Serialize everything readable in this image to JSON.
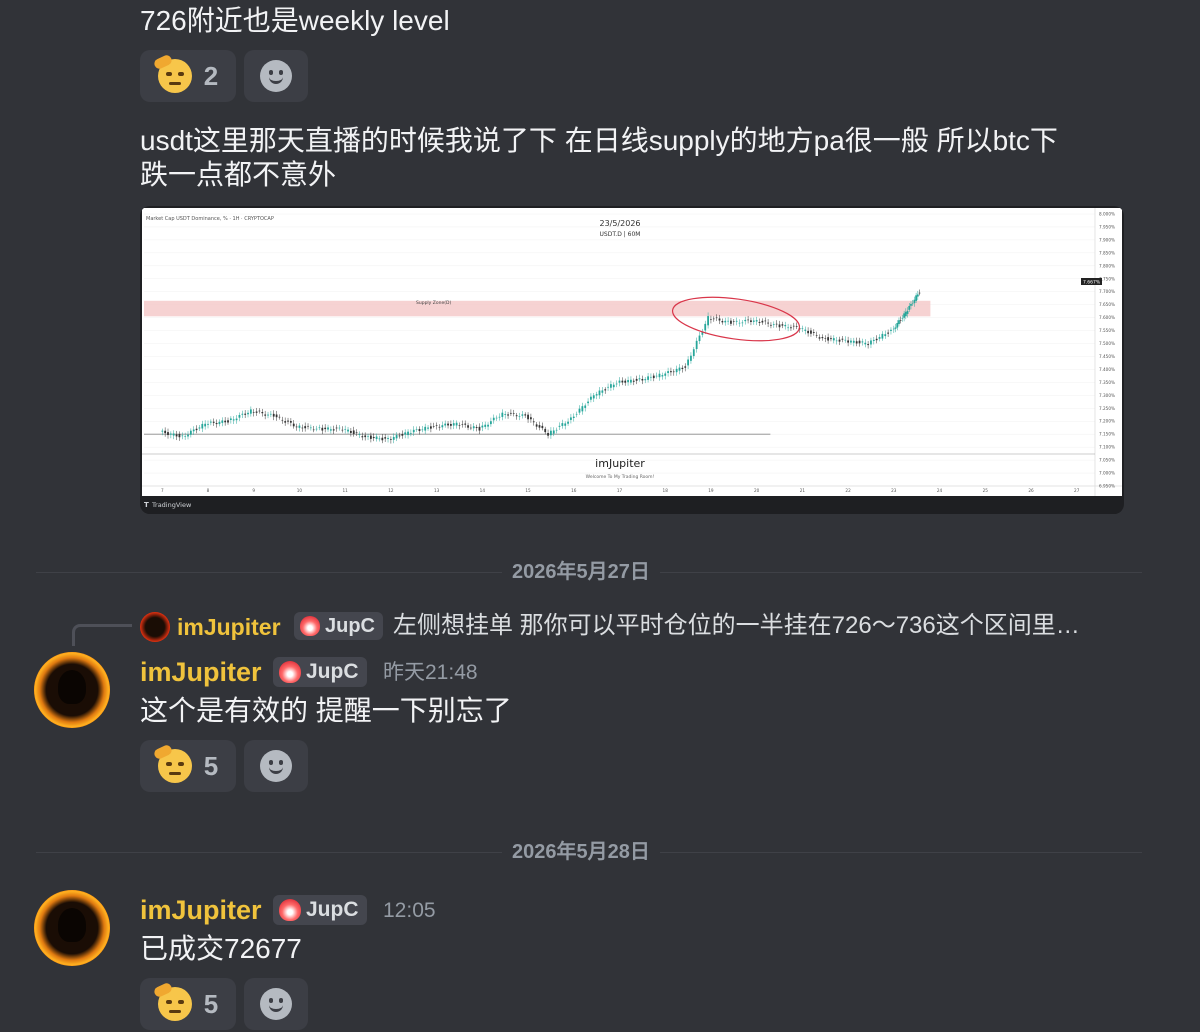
{
  "messages": {
    "m1": {
      "text": "726附近也是weekly level",
      "reaction_count": "2"
    },
    "m2": {
      "text_line1": "usdt这里那天直播的时候我说了下  在日线supply的地方pa很一般 所以btc下",
      "text_line2": "跌一点都不意外",
      "attachment_brand": "TradingView"
    },
    "divider1": "2026年5月27日",
    "m3": {
      "reply_username": "imJupiter",
      "reply_tag": "JupC",
      "reply_text": "左侧想挂单 那你可以平时仓位的一半挂在726～736这个区间里…",
      "username": "imJupiter",
      "tag": "JupC",
      "timestamp": "昨天21:48",
      "text": "这个是有效的 提醒一下别忘了",
      "reaction_count": "5"
    },
    "divider2": "2026年5月28日",
    "m4": {
      "username": "imJupiter",
      "tag": "JupC",
      "timestamp": "12:05",
      "text": "已成交72677",
      "reaction_count": "5"
    }
  },
  "chart_data": {
    "type": "line",
    "title": "23/5/2026",
    "subtitle": "USDT.D | 60M",
    "watermark": "imJupiter",
    "watermark_sub": "Welcome To My Trading Room!",
    "zone_label": "Supply Zone(D)",
    "header": "Market Cap USDT Dominance, % · 1H · CRYPTOCAP",
    "x_ticks": [
      "7",
      "8",
      "9",
      "10",
      "11",
      "12",
      "13",
      "14",
      "15",
      "16",
      "17",
      "18",
      "19",
      "20",
      "21",
      "22",
      "23",
      "24",
      "25",
      "26",
      "27"
    ],
    "y_ticks": [
      "8.000%",
      "7.950%",
      "7.900%",
      "7.850%",
      "7.800%",
      "7.750%",
      "7.700%",
      "7.650%",
      "7.600%",
      "7.550%",
      "7.500%",
      "7.450%",
      "7.400%",
      "7.350%",
      "7.300%",
      "7.250%",
      "7.200%",
      "7.150%",
      "7.100%",
      "7.050%",
      "7.000%",
      "6.950%"
    ],
    "ylim": [
      6.95,
      8.0
    ],
    "zone": [
      7.605,
      7.665
    ],
    "level": 7.15,
    "current_price": "7.667%",
    "x": [
      7.0,
      7.5,
      8.0,
      8.5,
      9.0,
      9.5,
      10.0,
      10.5,
      11.0,
      11.5,
      12.0,
      12.5,
      13.0,
      13.5,
      14.0,
      14.5,
      15.0,
      15.5,
      16.0,
      16.5,
      17.0,
      17.5,
      18.0,
      18.5,
      19.0,
      19.5,
      20.0,
      20.5,
      21.0,
      21.5,
      22.0,
      22.5,
      23.0,
      23.3,
      23.6
    ],
    "y": [
      7.16,
      7.14,
      7.19,
      7.2,
      7.24,
      7.22,
      7.18,
      7.17,
      7.17,
      7.14,
      7.13,
      7.16,
      7.18,
      7.19,
      7.17,
      7.23,
      7.22,
      7.15,
      7.21,
      7.3,
      7.35,
      7.36,
      7.38,
      7.41,
      7.6,
      7.58,
      7.59,
      7.57,
      7.56,
      7.52,
      7.51,
      7.5,
      7.55,
      7.62,
      7.7
    ],
    "colors": {
      "up": "#26a69a",
      "down": "#333333",
      "zone": "#f4c7c7",
      "annotation": "#d9364a"
    }
  },
  "colors": {
    "bg": "#313338",
    "username": "#f0c33c",
    "text": "#f2f3f5",
    "muted": "#949ba4",
    "reaction_bg": "#3c3e45"
  }
}
